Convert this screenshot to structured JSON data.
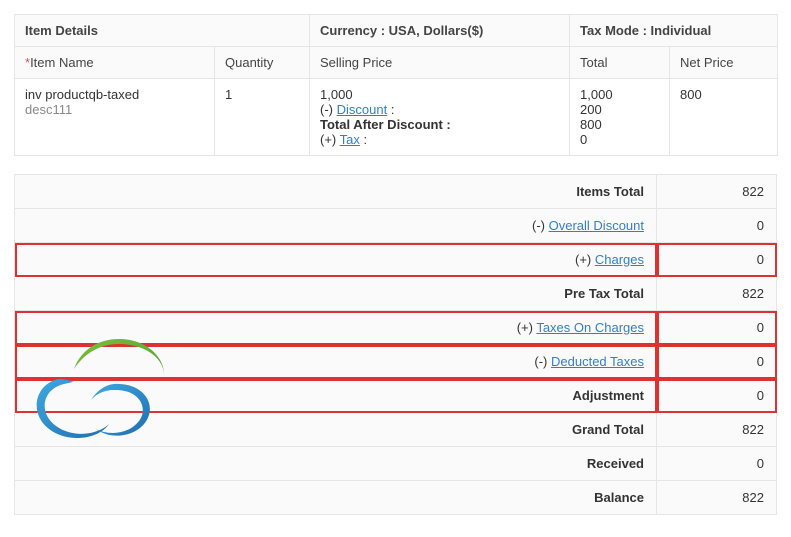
{
  "item_table": {
    "group_headers": {
      "item_details": "Item Details",
      "currency": "Currency : USA, Dollars($)",
      "tax_mode": "Tax Mode : Individual"
    },
    "col_headers": {
      "item_name": "Item Name",
      "quantity": "Quantity",
      "selling_price": "Selling Price",
      "total": "Total",
      "net_price": "Net Price"
    },
    "row": {
      "item_name": "inv productqb-taxed",
      "item_desc": "desc111",
      "quantity": "1",
      "selling_price_lines": {
        "base": "1,000",
        "discount_prefix": "(-) ",
        "discount_link": "Discount",
        "discount_suffix": " :",
        "after_discount": "Total After Discount :",
        "tax_prefix": "(+) ",
        "tax_link": "Tax",
        "tax_suffix": " :"
      },
      "total_lines": "1,000\n200\n800\n0",
      "net_price": "800"
    }
  },
  "summary": {
    "items_total": {
      "label": "Items Total",
      "value": "822"
    },
    "overall_discount": {
      "prefix": "(-) ",
      "link": "Overall Discount",
      "value": "0"
    },
    "charges": {
      "prefix": "(+) ",
      "link": "Charges",
      "value": "0"
    },
    "pre_tax_total": {
      "label": "Pre Tax Total",
      "value": "822"
    },
    "taxes_on_charges": {
      "prefix": "(+)  ",
      "link": "Taxes On Charges",
      "value": "0"
    },
    "deducted_taxes": {
      "prefix": "(-)  ",
      "link": "Deducted Taxes",
      "value": "0"
    },
    "adjustment": {
      "label": "Adjustment",
      "value": "0"
    },
    "grand_total": {
      "label": "Grand Total",
      "value": "822"
    },
    "received": {
      "label": "Received",
      "value": "0"
    },
    "balance": {
      "label": "Balance",
      "value": "822"
    }
  }
}
